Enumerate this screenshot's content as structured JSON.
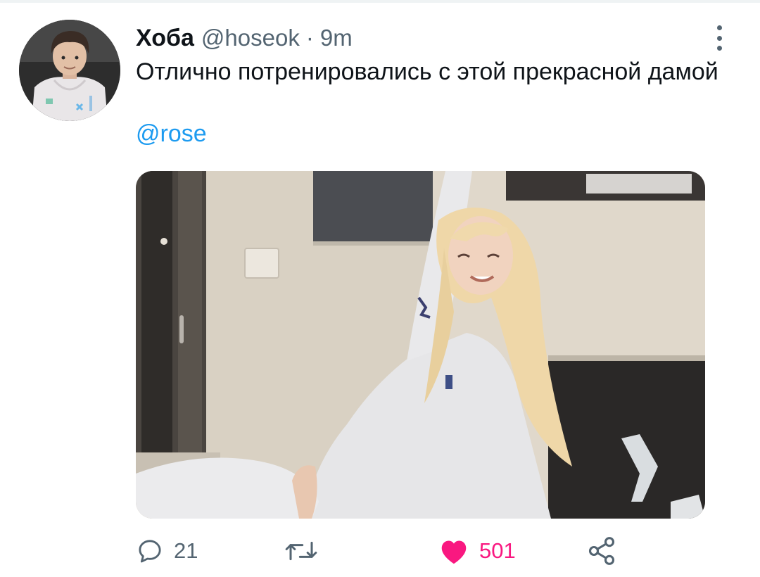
{
  "tweet": {
    "author_name": "Хоба",
    "author_handle": "@hoseok",
    "separator": "·",
    "time": "9m",
    "text": "Отлично потренировались с этой прекрасной дамой",
    "mention": "@rose"
  },
  "actions": {
    "reply_count": "21",
    "retweet_count": "",
    "like_count": "501",
    "liked": true
  },
  "icons": {
    "more": "more-vertical-icon",
    "reply": "reply-icon",
    "retweet": "retweet-icon",
    "like": "heart-icon",
    "share": "share-icon"
  },
  "colors": {
    "text": "#0f1419",
    "secondary": "#536471",
    "link": "#1d9bf0",
    "like": "#f91880"
  }
}
